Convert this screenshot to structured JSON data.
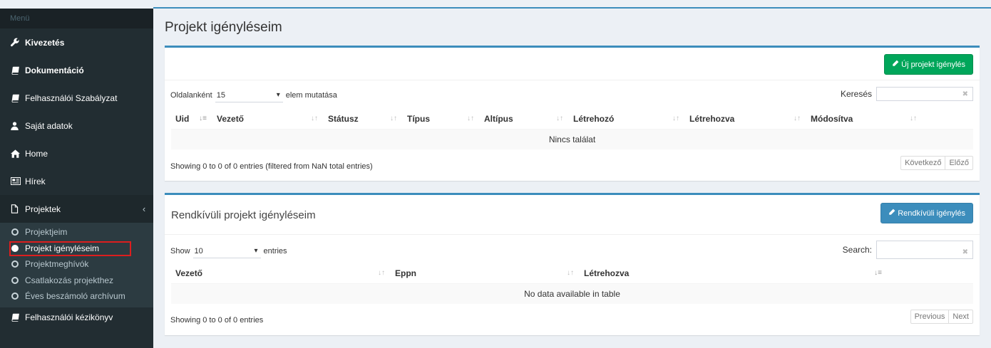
{
  "sidebar": {
    "header": "Menü",
    "items": [
      {
        "label": "Kivezetés",
        "icon": "wrench-icon"
      },
      {
        "label": "Dokumentáció",
        "icon": "book-icon"
      },
      {
        "label": "Felhasználói Szabályzat",
        "icon": "book-icon"
      },
      {
        "label": "Saját adatok",
        "icon": "user-icon"
      },
      {
        "label": "Home",
        "icon": "home-icon"
      },
      {
        "label": "Hírek",
        "icon": "newspaper-icon"
      },
      {
        "label": "Projektek",
        "icon": "file-icon"
      }
    ],
    "submenu": [
      {
        "label": "Projektjeim"
      },
      {
        "label": "Projekt igényléseim"
      },
      {
        "label": "Projektmeghívók"
      },
      {
        "label": "Csatlakozás projekthez"
      },
      {
        "label": "Éves beszámoló archívum"
      }
    ],
    "last_item": {
      "label": "Felhasználói kézikönyv",
      "icon": "book-icon"
    }
  },
  "page": {
    "title": "Projekt igényléseim"
  },
  "box1": {
    "button_label": "Új projekt igénylés",
    "length_prefix": "Oldalanként",
    "length_value": "15",
    "length_suffix": "elem mutatása",
    "search_label": "Keresés",
    "columns": [
      "Uid",
      "Vezető",
      "Státusz",
      "Típus",
      "Altípus",
      "Létrehozó",
      "Létrehozva",
      "Módosítva"
    ],
    "empty_text": "Nincs találat",
    "info": "Showing 0 to 0 of 0 entries (filtered from NaN total entries)",
    "pager_next": "Következő",
    "pager_prev": "Előző"
  },
  "box2": {
    "title": "Rendkívüli projekt igényléseim",
    "button_label": "Rendkívüli igénylés",
    "length_prefix": "Show",
    "length_value": "10",
    "length_suffix": "entries",
    "search_label": "Search:",
    "columns": [
      "Vezető",
      "Eppn",
      "Létrehozva"
    ],
    "empty_text": "No data available in table",
    "info": "Showing 0 to 0 of 0 entries",
    "pager_prev": "Previous",
    "pager_next": "Next"
  },
  "colors": {
    "primary": "#3c8dbc",
    "success": "#00a65a",
    "sidebar": "#222d32",
    "highlight": "#dd1e1e"
  }
}
